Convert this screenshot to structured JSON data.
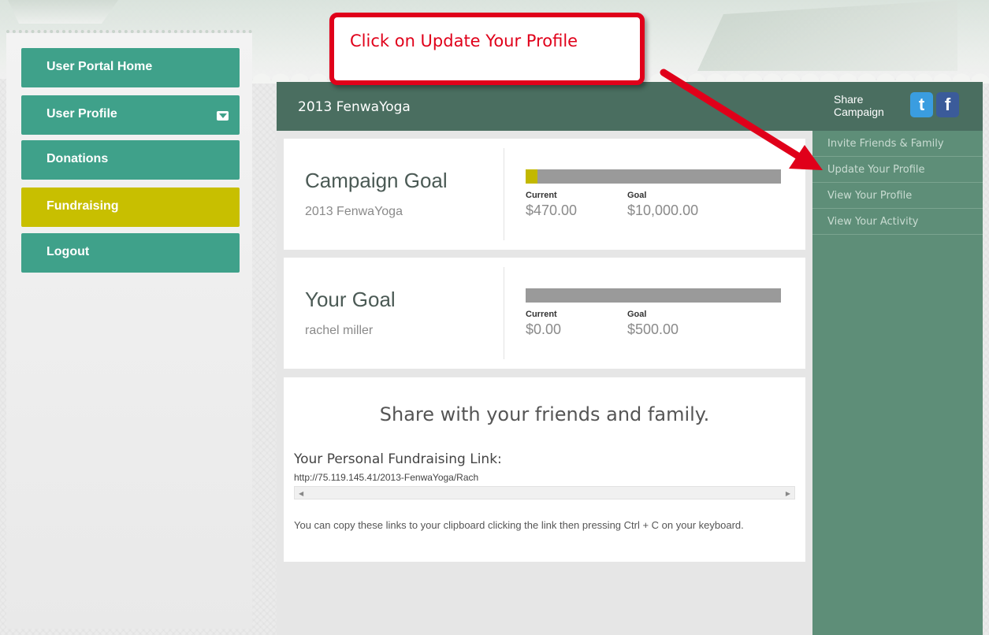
{
  "sidebar": {
    "items": [
      {
        "label": "User Portal Home",
        "active": false
      },
      {
        "label": "User Profile",
        "active": false,
        "has_dropdown": true
      },
      {
        "label": "Donations",
        "active": false
      },
      {
        "label": "Fundraising",
        "active": true
      },
      {
        "label": "Logout",
        "active": false
      }
    ]
  },
  "header": {
    "campaign_title": "2013 FenwaYoga",
    "share_label_line1": "Share",
    "share_label_line2": "Campaign",
    "twitter_glyph": "t",
    "facebook_glyph": "f"
  },
  "campaign_goal": {
    "title": "Campaign Goal",
    "subtitle": "2013 FenwaYoga",
    "current_label": "Current",
    "current_value": "$470.00",
    "goal_label": "Goal",
    "goal_value": "$10,000.00",
    "progress_fraction": 0.047
  },
  "your_goal": {
    "title": "Your Goal",
    "subtitle": "rachel miller",
    "current_label": "Current",
    "current_value": "$0.00",
    "goal_label": "Goal",
    "goal_value": "$500.00",
    "progress_fraction": 0
  },
  "share": {
    "heading": "Share with your friends and family.",
    "link_heading": "Your Personal Fundraising Link:",
    "link_url": "http://75.119.145.41/2013-FenwaYoga/Rach",
    "copy_note": "You can copy these links to your clipboard clicking the link then pressing Ctrl + C on your keyboard."
  },
  "right_menu": {
    "items": [
      "Invite Friends & Family",
      "Update Your Profile",
      "View Your Profile",
      "View Your Activity"
    ]
  },
  "annotation": {
    "text": "Click on Update Your Profile"
  },
  "colors": {
    "nav": "#3fa18a",
    "nav_active": "#c8bf00",
    "header": "#4a6e60",
    "right_panel": "#5e8e78",
    "progress": "#c2b800",
    "callout": "#e0001a"
  }
}
